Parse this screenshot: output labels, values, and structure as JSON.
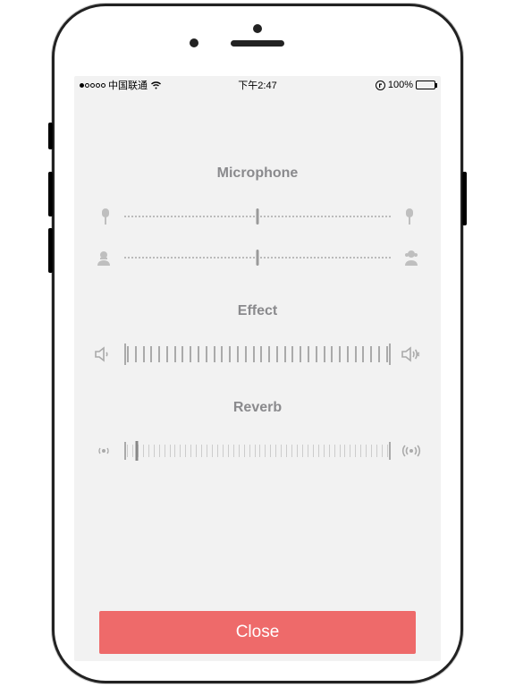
{
  "status": {
    "carrier": "中国联通",
    "time": "下午2:47",
    "battery_pct": "100%",
    "signal_filled": 1,
    "signal_total": 5
  },
  "sections": {
    "microphone": {
      "title": "Microphone"
    },
    "effect": {
      "title": "Effect"
    },
    "reverb": {
      "title": "Reverb"
    }
  },
  "sliders": {
    "earbud_balance": {
      "value_pct": 50
    },
    "voice_gender": {
      "value_pct": 50
    },
    "effect_level": {
      "value_pct": 100
    },
    "reverb_amount": {
      "value_pct": 4
    }
  },
  "buttons": {
    "close": "Close"
  },
  "icons": {
    "earbud_left": "earbud-left-icon",
    "earbud_right": "earbud-right-icon",
    "voice_male": "male-voice-icon",
    "voice_female": "female-voice-icon",
    "speaker_low": "speaker-low-icon",
    "speaker_high": "speaker-high-icon",
    "reverb_small": "reverb-small-icon",
    "reverb_large": "reverb-large-icon"
  }
}
